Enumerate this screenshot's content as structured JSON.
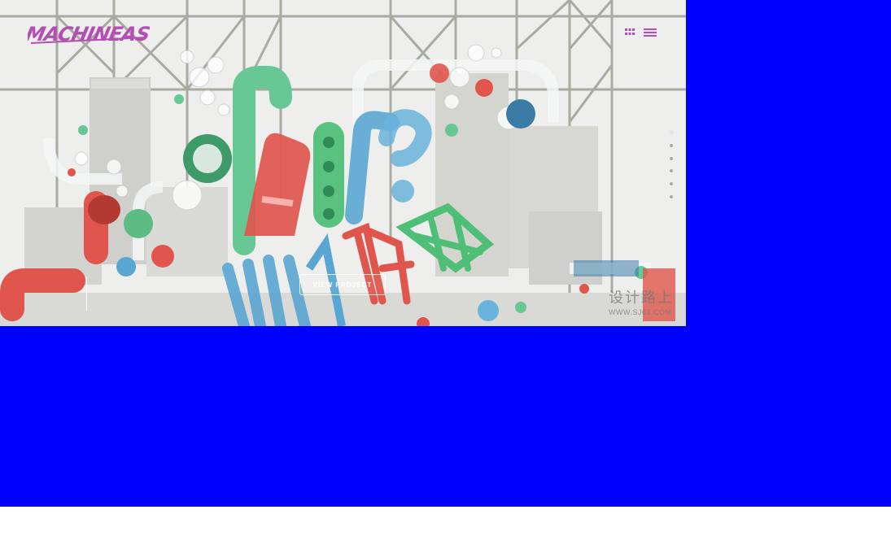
{
  "colors": {
    "background": "#0000ff",
    "page": "#ffffff",
    "hero_bg": "#eeeeec",
    "brand": "#b34fb3",
    "pipe_red": "#e0564d",
    "pipe_green": "#67c795",
    "pipe_blue": "#5aa6d2",
    "scaffold": "#a8ab9f"
  },
  "header": {
    "logo_text": "MACHINEAST",
    "grid_icon": "grid-icon",
    "menu_icon": "hamburger-menu-icon"
  },
  "hero": {
    "artwork": "3d-type-air-max-illustration",
    "cta_label": "VIEW PROJECT",
    "slides": {
      "count": 6,
      "active": 1
    }
  },
  "watermark": {
    "cn_text": "设计路上",
    "url_text": "WWW.SJ63.COM"
  }
}
